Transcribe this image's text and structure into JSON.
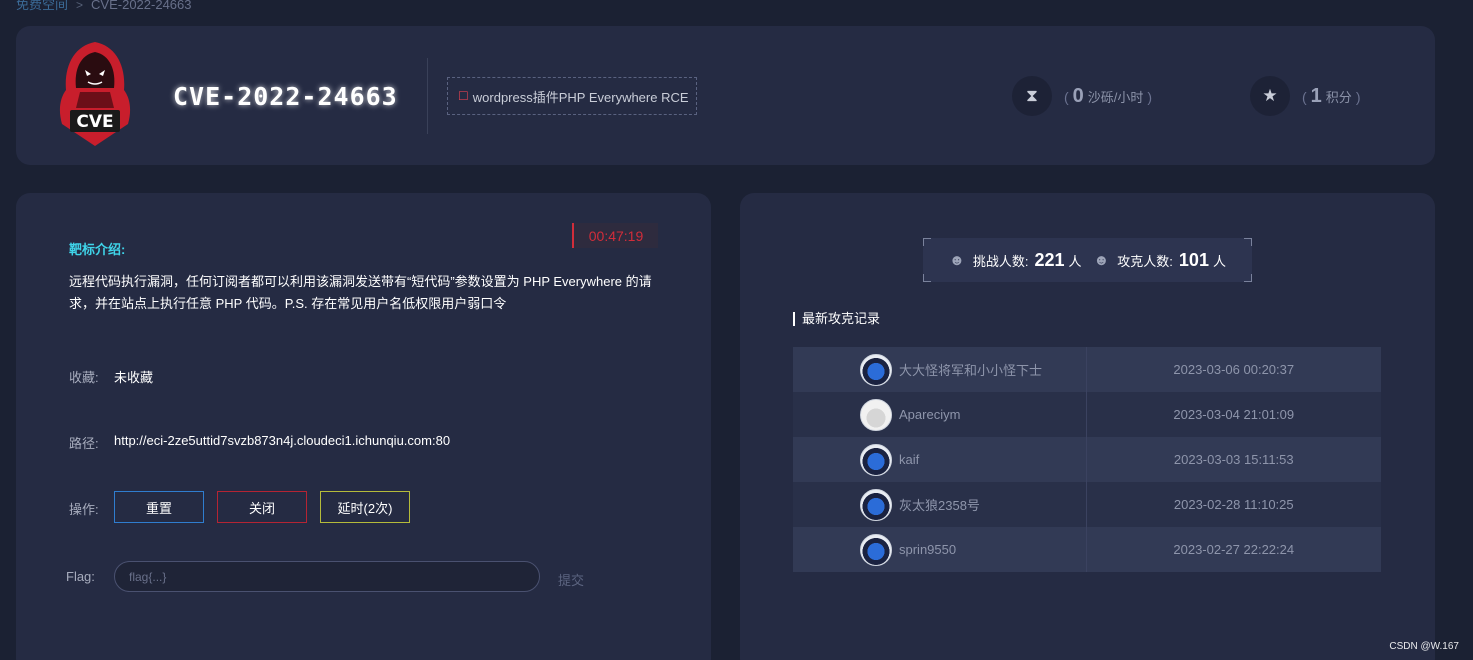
{
  "breadcrumb": {
    "root": "免费空间",
    "separator": ">",
    "current": "CVE-2022-24663"
  },
  "header": {
    "logo_text": "CVE",
    "title": "CVE-2022-24663",
    "tag": "wordpress插件PHP Everywhere RCE",
    "stats": [
      {
        "icon": "hourglass-icon",
        "value": "0",
        "unit": "沙砾/小时"
      },
      {
        "icon": "medal-icon",
        "value": "1",
        "unit": "积分"
      }
    ]
  },
  "left": {
    "timer": "00:47:19",
    "intro_title": "靶标介绍:",
    "intro_text": "远程代码执行漏洞，任何订阅者都可以利用该漏洞发送带有“短代码”参数设置为 PHP Everywhere 的请求，并在站点上执行任意 PHP 代码。P.S. 存在常见用户名低权限用户弱口令",
    "collect_label": "收藏:",
    "collect_value": "未收藏",
    "path_label": "路径:",
    "path_value": "http://eci-2ze5uttid7svzb873n4j.cloudeci1.ichunqiu.com:80",
    "ops_label": "操作:",
    "buttons": {
      "reset": "重置",
      "close": "关闭",
      "delay": "延时(2次)"
    },
    "flag_label": "Flag:",
    "flag_placeholder": "flag{...}",
    "submit": "提交"
  },
  "right": {
    "challengers_label": "挑战人数:",
    "challengers_value": "221",
    "challengers_unit": "人",
    "solvers_label": "攻克人数:",
    "solvers_value": "101",
    "solvers_unit": "人",
    "records_title": "最新攻克记录",
    "records": [
      {
        "user": "大大怪将军和小小怪下士",
        "time": "2023-03-06 00:20:37"
      },
      {
        "user": "Apareciym",
        "time": "2023-03-04 21:01:09"
      },
      {
        "user": "kaif",
        "time": "2023-03-03 15:11:53"
      },
      {
        "user": "灰太狼2358号",
        "time": "2023-02-28 11:10:25"
      },
      {
        "user": "sprin9550",
        "time": "2023-02-27 22:22:24"
      }
    ]
  },
  "watermark": "CSDN @W.167",
  "colors": {
    "background": "#1b2133",
    "card": "#252b43",
    "accent_cyan": "#3fd4e9",
    "timer_red": "#d12d3a"
  }
}
